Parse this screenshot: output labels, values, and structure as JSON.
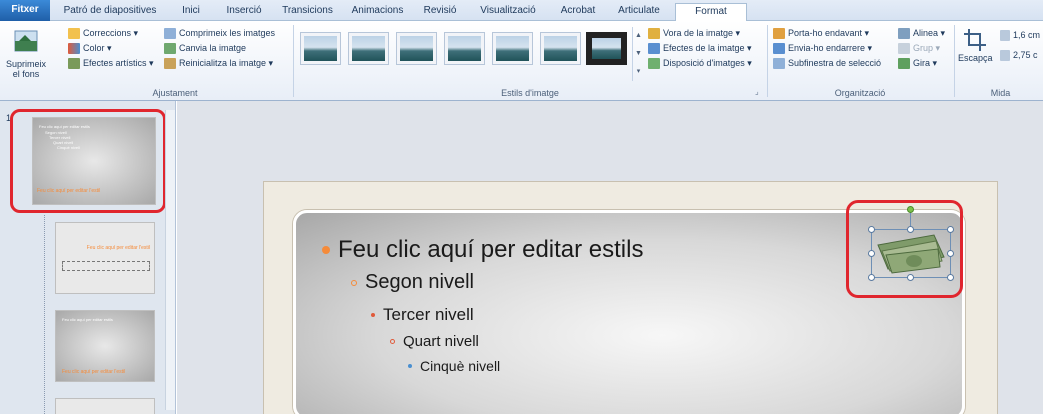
{
  "tabs": [
    {
      "label": "Fitxer"
    },
    {
      "label": "Patró de diapositives"
    },
    {
      "label": "Inici"
    },
    {
      "label": "Inserció"
    },
    {
      "label": "Transicions"
    },
    {
      "label": "Animacions"
    },
    {
      "label": "Revisió"
    },
    {
      "label": "Visualització"
    },
    {
      "label": "Acrobat"
    },
    {
      "label": "Articulate"
    },
    {
      "label": "Format"
    }
  ],
  "ribbon": {
    "remove_bg": "Suprimeix el fons",
    "adjust": {
      "corrections": "Correccions ▾",
      "color": "Color ▾",
      "artistic": "Efectes artístics ▾",
      "compress": "Comprimeix les imatges",
      "change": "Canvia la imatge",
      "reset": "Reinicialitza la imatge ▾",
      "label": "Ajustament"
    },
    "styles": {
      "label": "Estils d'imatge",
      "border": "Vora de la imatge ▾",
      "effects": "Efectes de la imatge ▾",
      "layout": "Disposició d'imatges ▾"
    },
    "arrange": {
      "forward": "Porta-ho endavant ▾",
      "backward": "Envia-ho endarrere ▾",
      "pane": "Subfinestra de selecció",
      "align": "Alinea ▾",
      "group": "Grup ▾",
      "rotate": "Gira ▾",
      "label": "Organització"
    },
    "size": {
      "crop": "Escapça",
      "height": "1,6 cm",
      "width": "2,75 c",
      "label": "Mida"
    }
  },
  "thumbnails": {
    "slide_number": "1",
    "master_title": "Feu clic aquí per editar estils",
    "master_levels": [
      "Segon nivell",
      "Tercer nivell",
      "Quart nivell",
      "Cinquè nivell"
    ],
    "master_footer": "Feu clic aquí per editar l'estil",
    "layout1_title": "Feu clic aquí per editar l'estil",
    "layout2_title": "Feu clic aquí per editar estils",
    "layout2_footer": "Feu clic aquí per editar l'estil"
  },
  "slide": {
    "level1": "Feu clic aquí per editar estils",
    "level2": "Segon nivell",
    "level3": "Tercer nivell",
    "level4": "Quart nivell",
    "level5": "Cinquè nivell"
  },
  "colors": {
    "accent": "#e0262e",
    "bullet_orange": "#f58b3a",
    "bullet_red": "#e05a3a",
    "bullet_blue": "#4a8fd0"
  }
}
